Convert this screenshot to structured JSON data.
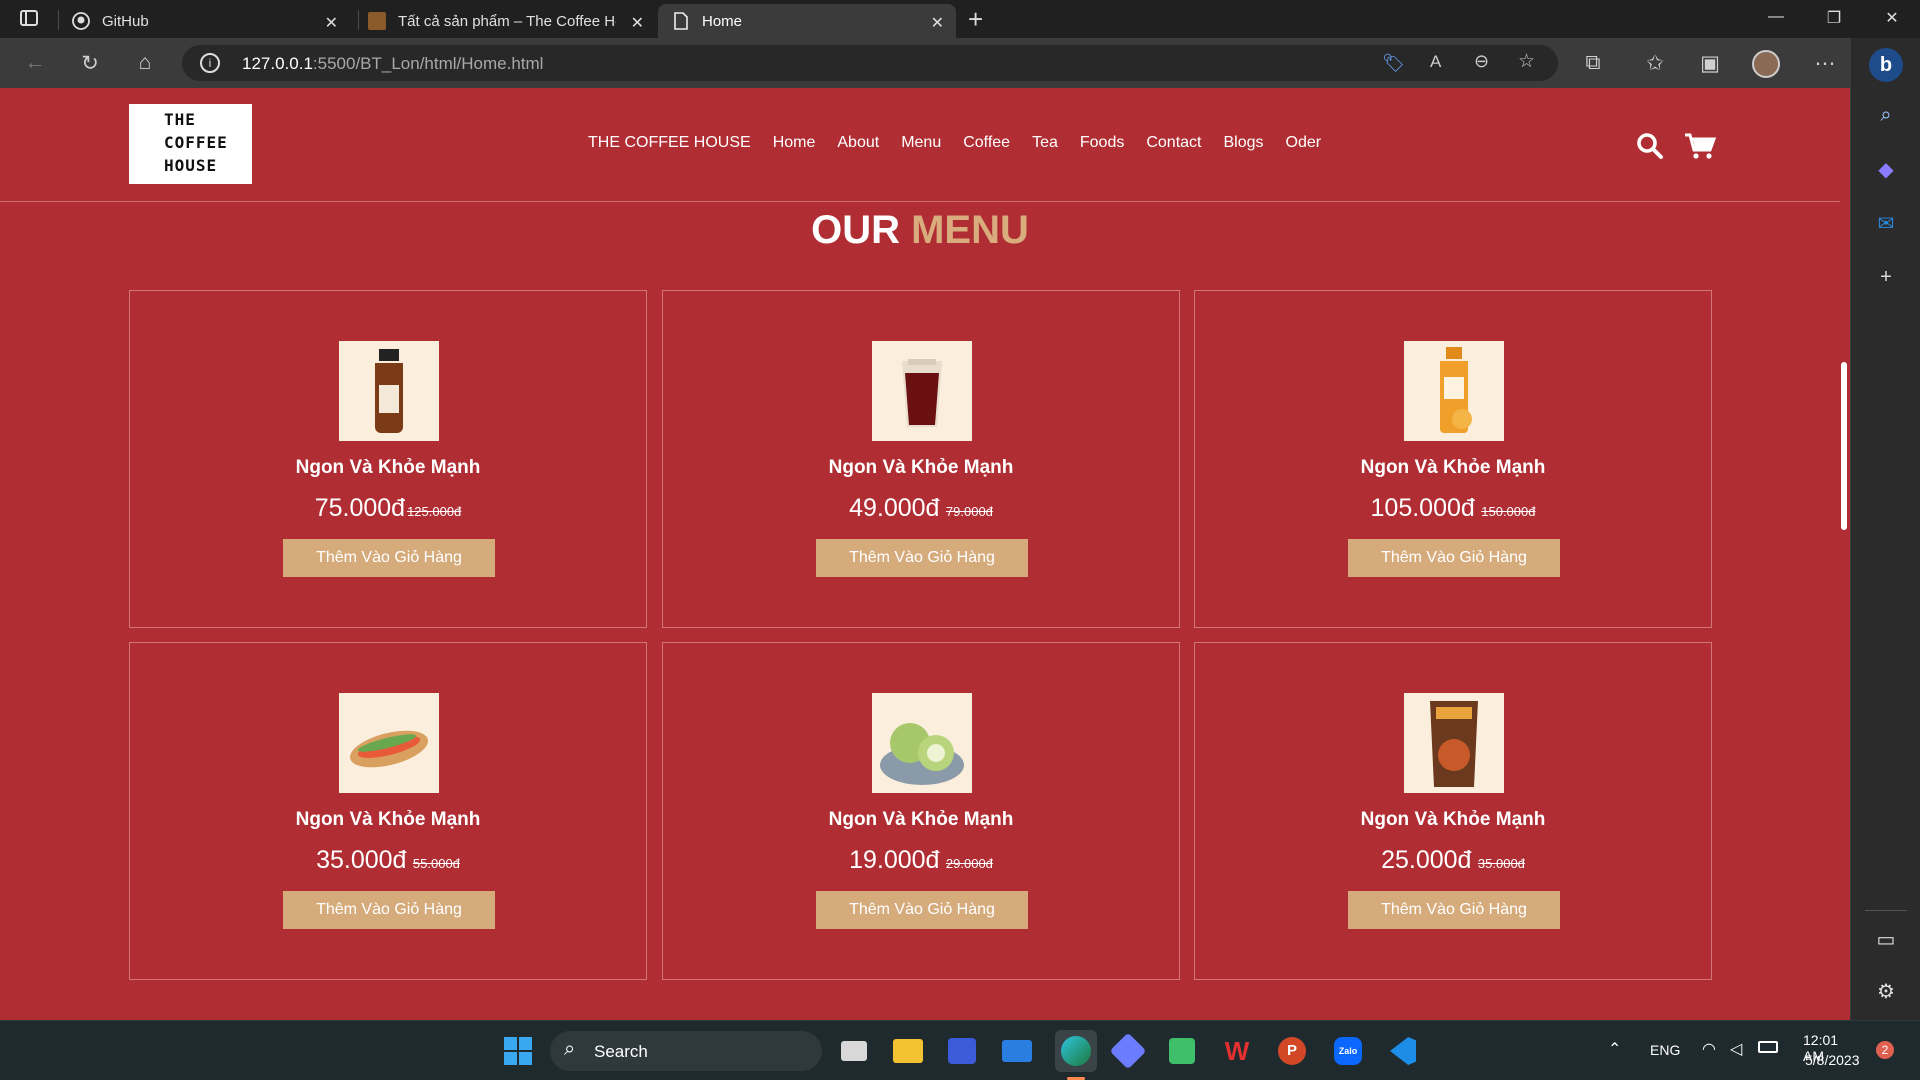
{
  "browser": {
    "tabs": [
      {
        "title": "GitHub",
        "active": false
      },
      {
        "title": "Tất cả sản phẩm – The Coffee Ho",
        "active": false
      },
      {
        "title": "Home",
        "active": true
      }
    ],
    "url_host": "127.0.0.1",
    "url_rest": ":5500/BT_Lon/html/Home.html"
  },
  "site": {
    "logo_lines": [
      "THE",
      "COFFEE",
      "HOUSE"
    ],
    "nav": [
      "THE COFFEE HOUSE",
      "Home",
      "About",
      "Menu",
      "Coffee",
      "Tea",
      "Foods",
      "Contact",
      "Blogs",
      "Oder"
    ],
    "menu_title_1": "OUR",
    "menu_title_2": "MENU",
    "products": [
      {
        "name": "Ngon Và Khỏe Mạnh",
        "price": "75.000đ",
        "old_price": "125.000đ",
        "button": "Thêm Vào Giỏ Hàng",
        "image": "bottle-coffee"
      },
      {
        "name": "Ngon Và Khỏe Mạnh",
        "price": "49.000đ",
        "old_price": "79.000đ",
        "button": "Thêm Vào Giỏ Hàng",
        "image": "iced-tea-glass"
      },
      {
        "name": "Ngon Và Khỏe Mạnh",
        "price": "105.000đ",
        "old_price": "150.000đ",
        "button": "Thêm Vào Giỏ Hàng",
        "image": "orange-tea-bottle"
      },
      {
        "name": "Ngon Và Khỏe Mạnh",
        "price": "35.000đ",
        "old_price": "55.000đ",
        "button": "Thêm Vào Giỏ Hàng",
        "image": "banh-mi"
      },
      {
        "name": "Ngon Và Khỏe Mạnh",
        "price": "19.000đ",
        "old_price": "29.000đ",
        "button": "Thêm Vào Giỏ Hàng",
        "image": "green-cakes"
      },
      {
        "name": "Ngon Và Khỏe Mạnh",
        "price": "25.000đ",
        "old_price": "35.000đ",
        "button": "Thêm Vào Giỏ Hàng",
        "image": "snack-bag"
      }
    ]
  },
  "taskbar": {
    "search_label": "Search",
    "lang": "ENG",
    "time": "12:01 AM",
    "date": "5/8/2023",
    "notifications": "2"
  },
  "colors": {
    "page_bg": "#b02d33",
    "accent": "#d9ac7e",
    "button": "#d6ab7c"
  }
}
